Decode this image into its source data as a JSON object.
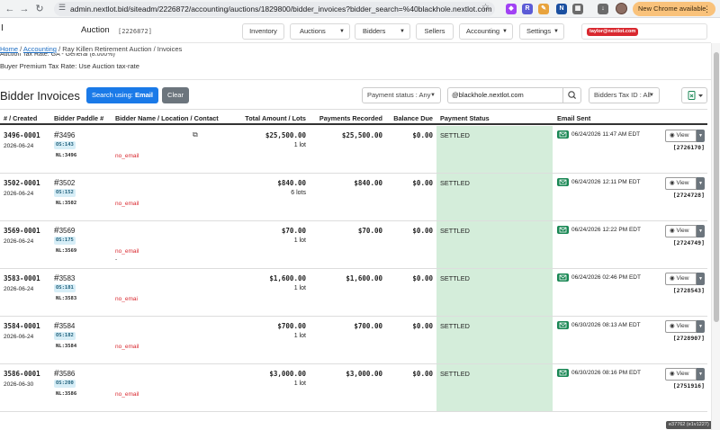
{
  "browser": {
    "url": "admin.nextlot.bid/siteadm/2226872/accounting/auctions/1829800/bidder_invoices?bidder_search=%40blackhole.nextlot.com",
    "update_label": "New Chrome available"
  },
  "header": {
    "cursor": "I",
    "title": "Auction",
    "auction_id": "[2226872]",
    "nav": [
      {
        "label": "Inventory"
      },
      {
        "label": "Auctions"
      },
      {
        "label": "Bidders"
      },
      {
        "label": "Sellers"
      },
      {
        "label": "Accounting"
      },
      {
        "label": "Settings"
      }
    ],
    "user_email": "taylor@nextlot.com"
  },
  "breadcrumb": {
    "home": "Home",
    "accounting": "Accounting",
    "auction": "Ray Killen Retirement Auction",
    "current": "Invoices"
  },
  "info": {
    "clipped_line": "Auction Tax Rate: GA - General (8.000%)",
    "premium_line": "Buyer Premium Tax Rate: Use Auction tax-rate"
  },
  "toolbar": {
    "heading": "Bidder Invoices",
    "search_using_label": "Search using:",
    "search_using_value": "Email",
    "clear_label": "Clear",
    "payment_status_filter": "Payment status : Any",
    "search_value": "@blackhole.nextlot.com",
    "tax_id_filter": "Bidders Tax ID : All"
  },
  "table": {
    "columns": {
      "created": "# / Created",
      "paddle": "Bidder Paddle #",
      "name": "Bidder Name / Location / Contact",
      "total": "Total Amount / Lots",
      "payments": "Payments Recorded",
      "balance": "Balance Due",
      "status": "Payment Status",
      "email": "Email Sent"
    },
    "view_label": "View",
    "rows": [
      {
        "number": "3496-0001",
        "date": "2026-06-24",
        "paddle": "3496",
        "os": "OS:143",
        "nl": "NL:3496",
        "contact": "no_email",
        "extra": "",
        "total": "$25,500.00",
        "lots": "1 lot",
        "paid": "$25,500.00",
        "balance": "$0.00",
        "status": "SETTLED",
        "sent": "06/24/2026 11:47 AM EDT",
        "invoice_id": "[2726170]"
      },
      {
        "number": "3502-0001",
        "date": "2026-06-24",
        "paddle": "3502",
        "os": "OS:152",
        "nl": "NL:3502",
        "contact": "no_email",
        "extra": "",
        "total": "$840.00",
        "lots": "6 lots",
        "paid": "$840.00",
        "balance": "$0.00",
        "status": "SETTLED",
        "sent": "06/24/2026 12:11 PM EDT",
        "invoice_id": "[2724728]"
      },
      {
        "number": "3569-0001",
        "date": "2026-06-24",
        "paddle": "3569",
        "os": "OS:175",
        "nl": "NL:3569",
        "contact": "no_email",
        "extra": "-",
        "total": "$70.00",
        "lots": "1 lot",
        "paid": "$70.00",
        "balance": "$0.00",
        "status": "SETTLED",
        "sent": "06/24/2026 12:22 PM EDT",
        "invoice_id": "[2724749]"
      },
      {
        "number": "3583-0001",
        "date": "2026-06-24",
        "paddle": "3583",
        "os": "OS:181",
        "nl": "NL:3583",
        "contact": "no_emai",
        "extra": "",
        "total": "$1,600.00",
        "lots": "1 lot",
        "paid": "$1,600.00",
        "balance": "$0.00",
        "status": "SETTLED",
        "sent": "06/24/2026 02:46 PM EDT",
        "invoice_id": "[2728543]"
      },
      {
        "number": "3584-0001",
        "date": "2026-06-24",
        "paddle": "3584",
        "os": "OS:182",
        "nl": "NL:3584",
        "contact": "no_email",
        "extra": "",
        "total": "$700.00",
        "lots": "1 lot",
        "paid": "$700.00",
        "balance": "$0.00",
        "status": "SETTLED",
        "sent": "06/30/2026 08:13 AM EDT",
        "invoice_id": "[2728907]"
      },
      {
        "number": "3586-0001",
        "date": "2026-06-30",
        "paddle": "3586",
        "os": "OS:200",
        "nl": "NL:3586",
        "contact": "no_email",
        "extra": "",
        "total": "$3,000.00",
        "lots": "1 lot",
        "paid": "$3,000.00",
        "balance": "$0.00",
        "status": "SETTLED",
        "sent": "06/30/2026 08:16 PM EDT",
        "invoice_id": "[2751916]"
      }
    ]
  },
  "footer": {
    "badge": "e37762 (e1v1227)"
  },
  "colors": {
    "primary": "#1a7ae8",
    "settled": "#d4edda",
    "danger": "#d9282f",
    "mail": "#198754"
  }
}
